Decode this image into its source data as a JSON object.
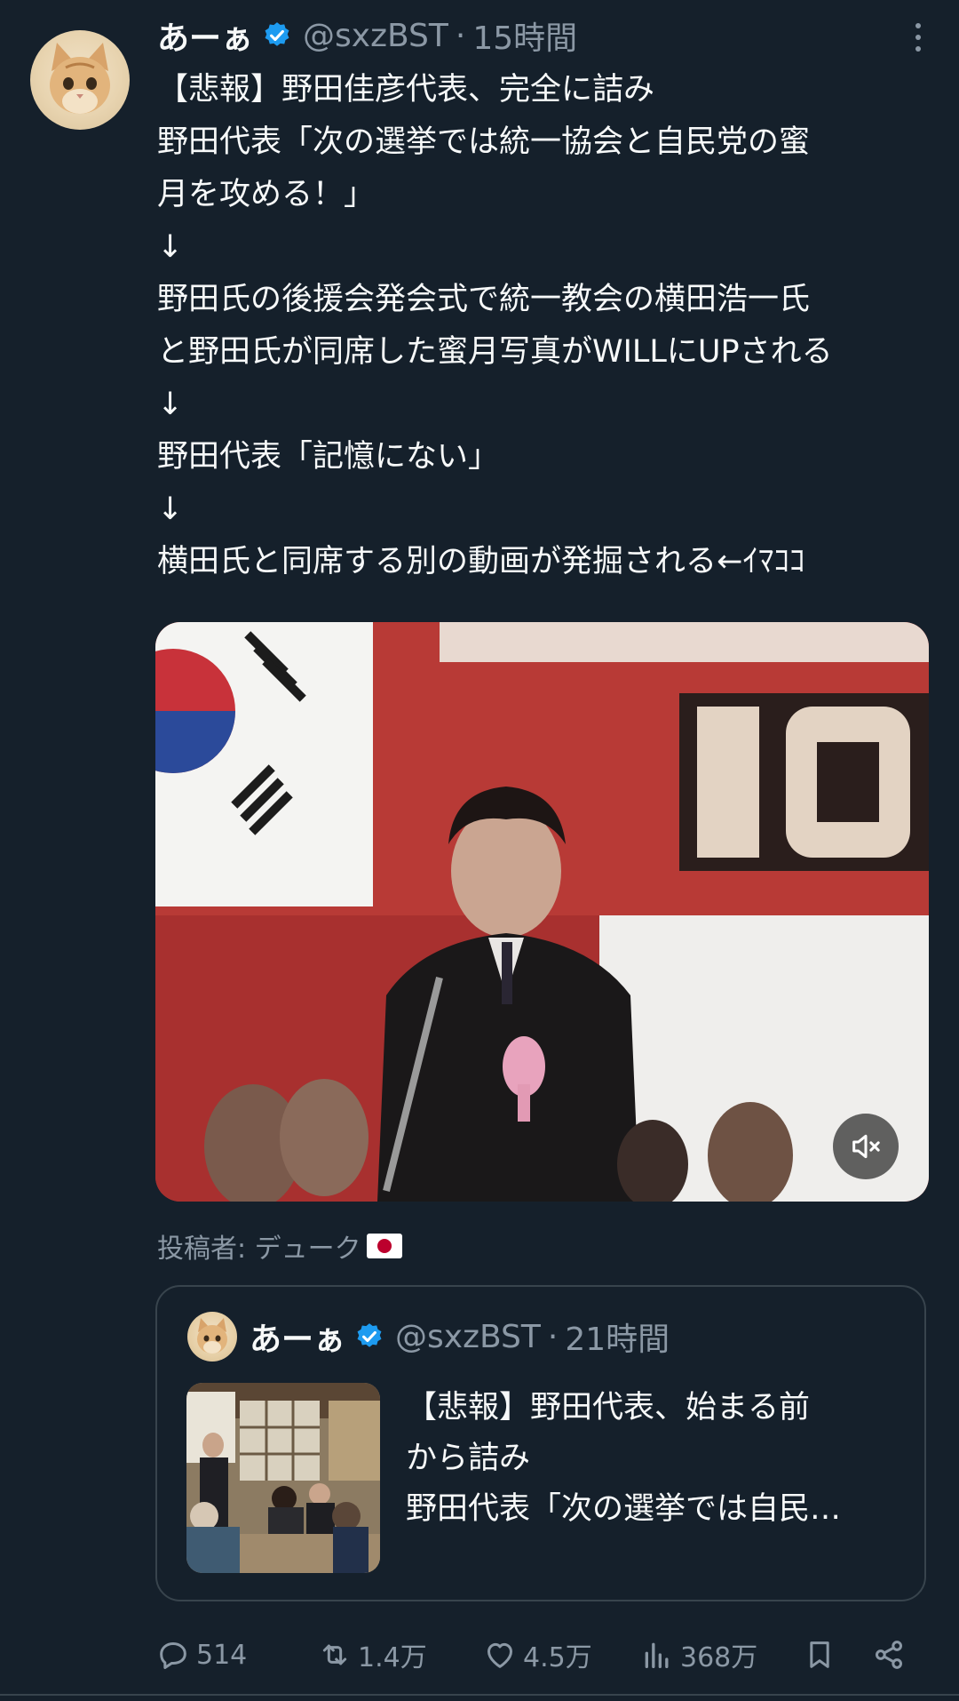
{
  "post": {
    "author_name": "あーぁ",
    "handle": "@sxzBST",
    "separator": "·",
    "time": "15時間",
    "lines": [
      "【悲報】野田佳彦代表、完全に詰み",
      "",
      "野田代表「次の選挙では統一協会と自民党の蜜",
      "月を攻める！」",
      "↓",
      "野田氏の後援会発会式で統一教会の横田浩一氏",
      "と野田氏が同席した蜜月写真がWILLにUPされる",
      "↓",
      "野田代表「記憶にない」",
      "↓",
      "横田氏と同席する別の動画が発掘される←ｲﾏｺｺ"
    ],
    "media_credit": "投稿者: デューク"
  },
  "quote": {
    "author_name": "あーぁ",
    "handle": "@sxzBST",
    "separator": "·",
    "time": "21時間",
    "lines": [
      "【悲報】野田代表、始まる前",
      "から詰み",
      "",
      "野田代表「次の選挙では自民…"
    ]
  },
  "actions": {
    "replies": "514",
    "reposts": "1.4万",
    "likes": "4.5万",
    "views": "368万"
  },
  "colors": {
    "background": "#15202b",
    "text": "#f7f9f9",
    "secondary": "#8b98a5",
    "verified": "#1d9bf0",
    "border": "#38444d"
  },
  "icons": [
    "verified-badge-icon",
    "more-options-icon",
    "mute-icon",
    "reply-icon",
    "repost-icon",
    "like-icon",
    "views-icon",
    "bookmark-icon",
    "share-icon",
    "japan-flag-icon"
  ]
}
